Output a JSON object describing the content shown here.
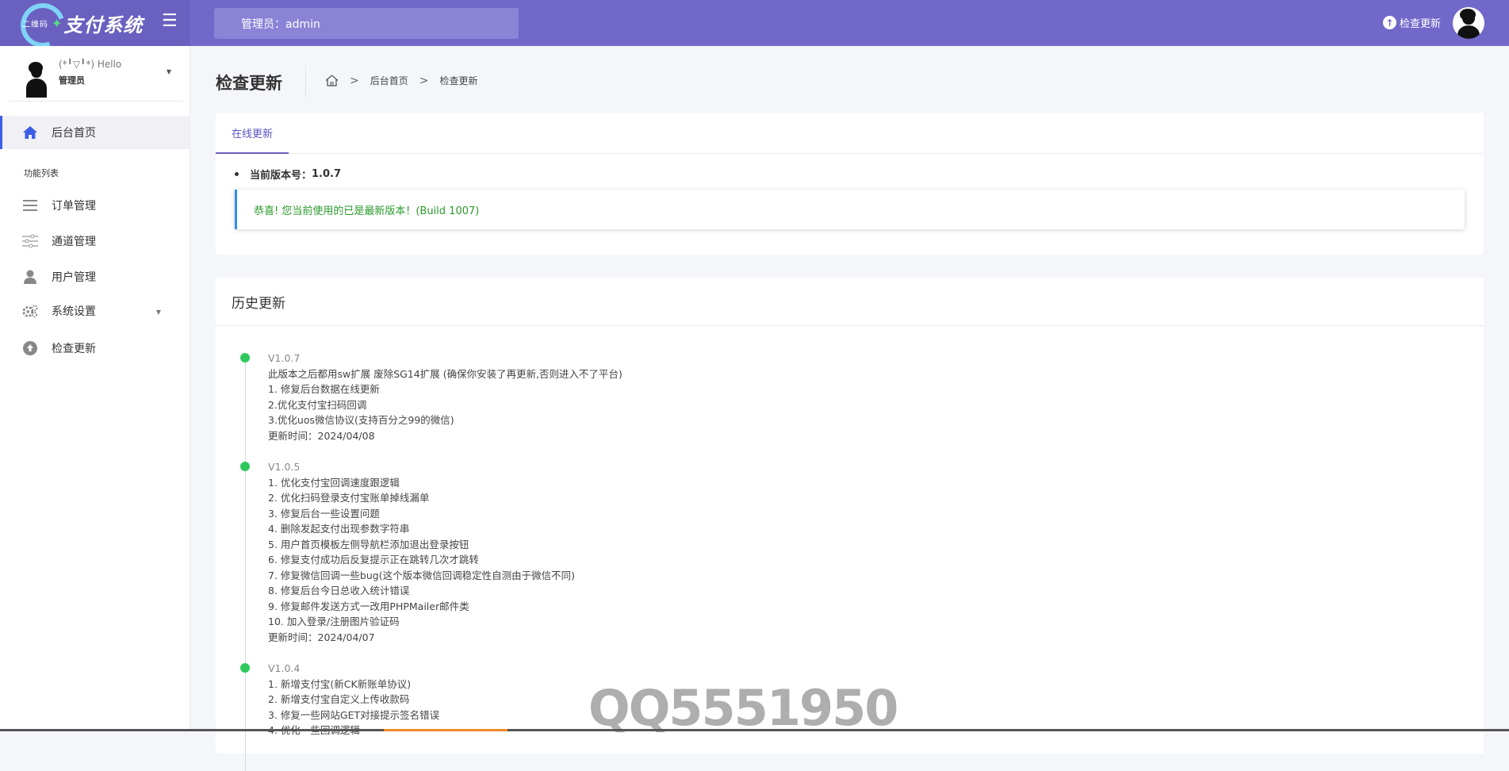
{
  "brand": {
    "small": "二维码",
    "name": "支付系统",
    "icon": "logo-arc-icon",
    "accent": "#7168c9"
  },
  "topbar": {
    "admin_label": "管理员：admin",
    "update_label": "检查更新"
  },
  "sidebar": {
    "user_hello": "(*╹▽╹*) Hello",
    "user_role": "管理员",
    "section_label": "功能列表",
    "items": [
      {
        "label": "后台首页",
        "icon": "home-icon"
      },
      {
        "label": "订单管理",
        "icon": "list-icon"
      },
      {
        "label": "通道管理",
        "icon": "sliders-icon"
      },
      {
        "label": "用户管理",
        "icon": "user-icon"
      },
      {
        "label": "系统设置",
        "icon": "gear-icon"
      },
      {
        "label": "检查更新",
        "icon": "upload-circle-icon"
      }
    ]
  },
  "page": {
    "title": "检查更新",
    "breadcrumb": [
      "后台首页",
      "检查更新"
    ]
  },
  "online_update": {
    "tab_label": "在线更新",
    "version_label": "当前版本号：",
    "version_value": "1.0.7",
    "alert_text": "恭喜! 您当前使用的已是最新版本！(Build 1007)",
    "alert_color": "#2a9a2a"
  },
  "history": {
    "title": "历史更新",
    "entries": [
      {
        "version": "V1.0.7",
        "lines": [
          "此版本之后都用sw扩展 废除SG14扩展 (确保你安装了再更新,否则进入不了平台)",
          "1. 修复后台数据在线更新",
          "2.优化支付宝扫码回调",
          "3.优化uos微信协议(支持百分之99的微信)",
          "更新时间：2024/04/08"
        ]
      },
      {
        "version": "V1.0.5",
        "lines": [
          "1. 优化支付宝回调速度跟逻辑",
          "2. 优化扫码登录支付宝账单掉线漏单",
          "3. 修复后台一些设置问题",
          "4. 删除发起支付出现参数字符串",
          "5. 用户首页模板左侧导航栏添加退出登录按钮",
          "6. 修复支付成功后反复提示正在跳转几次才跳转",
          "7. 修复微信回调一些bug(这个版本微信回调稳定性自测由于微信不同)",
          "8. 修复后台今日总收入统计错误",
          "9. 修复邮件发送方式一改用PHPMailer邮件类",
          "10. 加入登录/注册图片验证码",
          "更新时间：2024/04/07"
        ]
      },
      {
        "version": "V1.0.4",
        "lines": [
          "1. 新增支付宝(新CK新账单协议)",
          "2. 新增支付宝自定义上传收款码",
          "3. 修复一些网站GET对接提示签名错误",
          "4. 优化一些回调逻辑"
        ]
      }
    ]
  },
  "watermark": "QQ5551950"
}
